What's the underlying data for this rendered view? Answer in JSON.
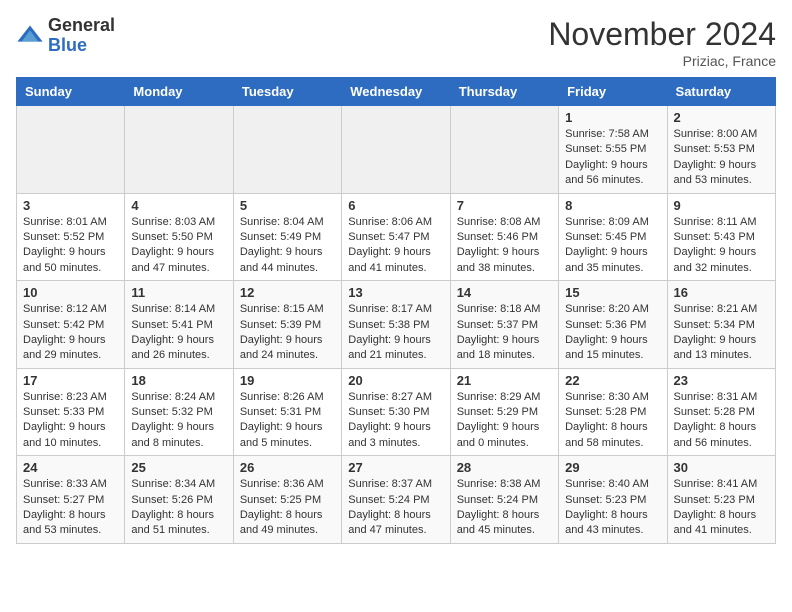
{
  "logo": {
    "line1": "General",
    "line2": "Blue"
  },
  "header": {
    "title": "November 2024",
    "location": "Priziac, France"
  },
  "weekdays": [
    "Sunday",
    "Monday",
    "Tuesday",
    "Wednesday",
    "Thursday",
    "Friday",
    "Saturday"
  ],
  "weeks": [
    [
      {
        "day": "",
        "info": ""
      },
      {
        "day": "",
        "info": ""
      },
      {
        "day": "",
        "info": ""
      },
      {
        "day": "",
        "info": ""
      },
      {
        "day": "",
        "info": ""
      },
      {
        "day": "1",
        "info": "Sunrise: 7:58 AM\nSunset: 5:55 PM\nDaylight: 9 hours and 56 minutes."
      },
      {
        "day": "2",
        "info": "Sunrise: 8:00 AM\nSunset: 5:53 PM\nDaylight: 9 hours and 53 minutes."
      }
    ],
    [
      {
        "day": "3",
        "info": "Sunrise: 8:01 AM\nSunset: 5:52 PM\nDaylight: 9 hours and 50 minutes."
      },
      {
        "day": "4",
        "info": "Sunrise: 8:03 AM\nSunset: 5:50 PM\nDaylight: 9 hours and 47 minutes."
      },
      {
        "day": "5",
        "info": "Sunrise: 8:04 AM\nSunset: 5:49 PM\nDaylight: 9 hours and 44 minutes."
      },
      {
        "day": "6",
        "info": "Sunrise: 8:06 AM\nSunset: 5:47 PM\nDaylight: 9 hours and 41 minutes."
      },
      {
        "day": "7",
        "info": "Sunrise: 8:08 AM\nSunset: 5:46 PM\nDaylight: 9 hours and 38 minutes."
      },
      {
        "day": "8",
        "info": "Sunrise: 8:09 AM\nSunset: 5:45 PM\nDaylight: 9 hours and 35 minutes."
      },
      {
        "day": "9",
        "info": "Sunrise: 8:11 AM\nSunset: 5:43 PM\nDaylight: 9 hours and 32 minutes."
      }
    ],
    [
      {
        "day": "10",
        "info": "Sunrise: 8:12 AM\nSunset: 5:42 PM\nDaylight: 9 hours and 29 minutes."
      },
      {
        "day": "11",
        "info": "Sunrise: 8:14 AM\nSunset: 5:41 PM\nDaylight: 9 hours and 26 minutes."
      },
      {
        "day": "12",
        "info": "Sunrise: 8:15 AM\nSunset: 5:39 PM\nDaylight: 9 hours and 24 minutes."
      },
      {
        "day": "13",
        "info": "Sunrise: 8:17 AM\nSunset: 5:38 PM\nDaylight: 9 hours and 21 minutes."
      },
      {
        "day": "14",
        "info": "Sunrise: 8:18 AM\nSunset: 5:37 PM\nDaylight: 9 hours and 18 minutes."
      },
      {
        "day": "15",
        "info": "Sunrise: 8:20 AM\nSunset: 5:36 PM\nDaylight: 9 hours and 15 minutes."
      },
      {
        "day": "16",
        "info": "Sunrise: 8:21 AM\nSunset: 5:34 PM\nDaylight: 9 hours and 13 minutes."
      }
    ],
    [
      {
        "day": "17",
        "info": "Sunrise: 8:23 AM\nSunset: 5:33 PM\nDaylight: 9 hours and 10 minutes."
      },
      {
        "day": "18",
        "info": "Sunrise: 8:24 AM\nSunset: 5:32 PM\nDaylight: 9 hours and 8 minutes."
      },
      {
        "day": "19",
        "info": "Sunrise: 8:26 AM\nSunset: 5:31 PM\nDaylight: 9 hours and 5 minutes."
      },
      {
        "day": "20",
        "info": "Sunrise: 8:27 AM\nSunset: 5:30 PM\nDaylight: 9 hours and 3 minutes."
      },
      {
        "day": "21",
        "info": "Sunrise: 8:29 AM\nSunset: 5:29 PM\nDaylight: 9 hours and 0 minutes."
      },
      {
        "day": "22",
        "info": "Sunrise: 8:30 AM\nSunset: 5:28 PM\nDaylight: 8 hours and 58 minutes."
      },
      {
        "day": "23",
        "info": "Sunrise: 8:31 AM\nSunset: 5:28 PM\nDaylight: 8 hours and 56 minutes."
      }
    ],
    [
      {
        "day": "24",
        "info": "Sunrise: 8:33 AM\nSunset: 5:27 PM\nDaylight: 8 hours and 53 minutes."
      },
      {
        "day": "25",
        "info": "Sunrise: 8:34 AM\nSunset: 5:26 PM\nDaylight: 8 hours and 51 minutes."
      },
      {
        "day": "26",
        "info": "Sunrise: 8:36 AM\nSunset: 5:25 PM\nDaylight: 8 hours and 49 minutes."
      },
      {
        "day": "27",
        "info": "Sunrise: 8:37 AM\nSunset: 5:24 PM\nDaylight: 8 hours and 47 minutes."
      },
      {
        "day": "28",
        "info": "Sunrise: 8:38 AM\nSunset: 5:24 PM\nDaylight: 8 hours and 45 minutes."
      },
      {
        "day": "29",
        "info": "Sunrise: 8:40 AM\nSunset: 5:23 PM\nDaylight: 8 hours and 43 minutes."
      },
      {
        "day": "30",
        "info": "Sunrise: 8:41 AM\nSunset: 5:23 PM\nDaylight: 8 hours and 41 minutes."
      }
    ]
  ]
}
